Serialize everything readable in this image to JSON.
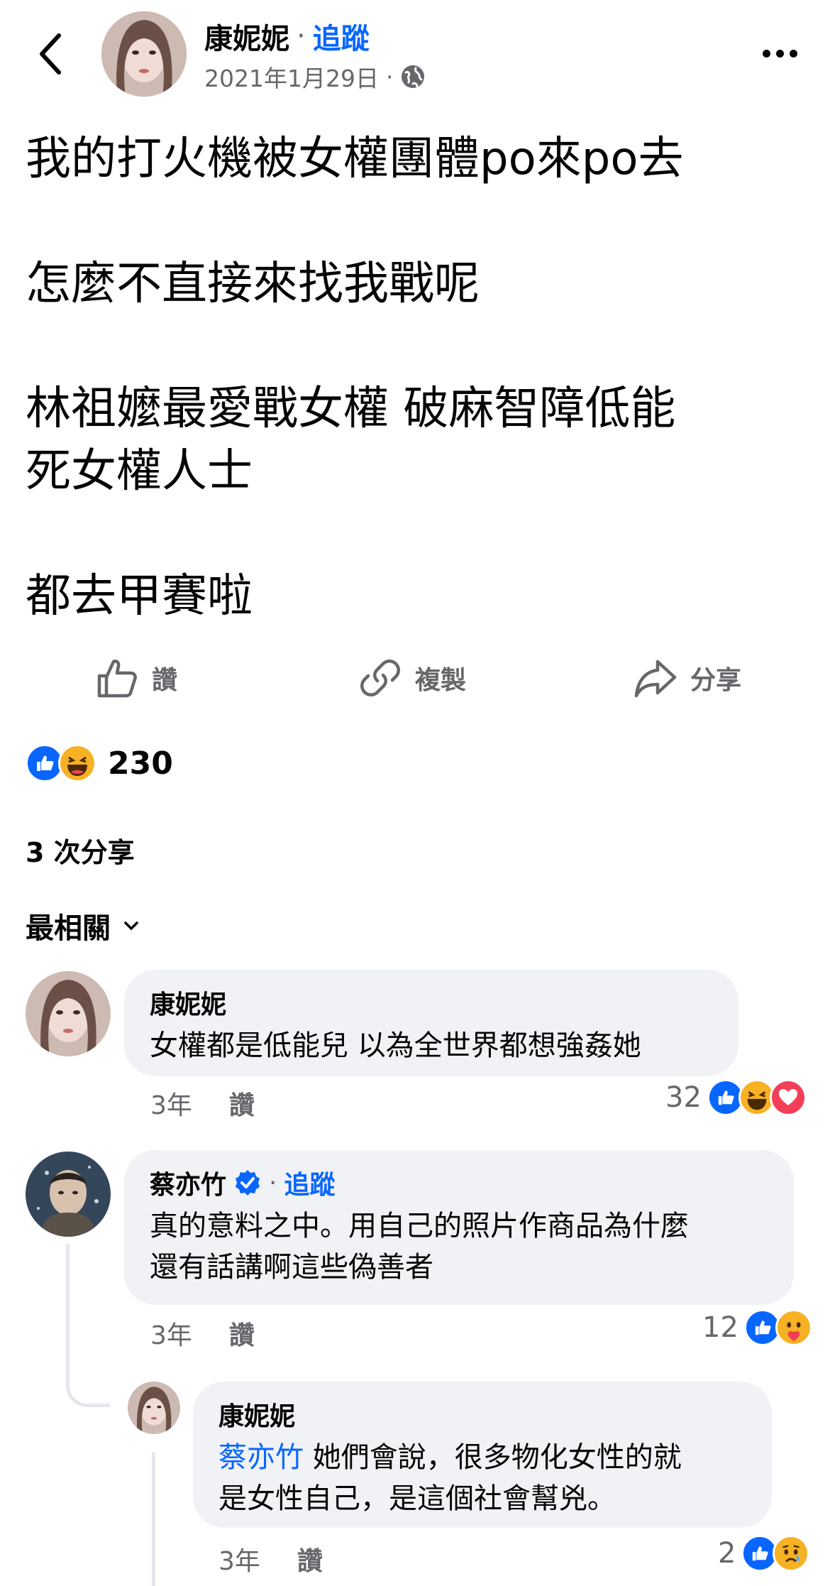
{
  "header": {
    "author": "康妮妮",
    "separator": "·",
    "follow": "追蹤",
    "date": "2021年1月29日",
    "date_dot": "·",
    "privacy_icon": "globe-icon"
  },
  "post": {
    "text": "我的打火機被女權團體po來po去\n\n怎麼不直接來找我戰呢\n\n林祖嬤最愛戰女權 破麻智障低能\n死女權人士\n\n都去甲賽啦"
  },
  "actions": {
    "like": "讚",
    "copy": "複製",
    "share": "分享"
  },
  "reactions": {
    "count": "230",
    "icons": [
      "like-icon",
      "haha-icon"
    ]
  },
  "shares_text": "3 次分享",
  "sort_label": "最相關",
  "comments": [
    {
      "name": "康妮妮",
      "text": "女權都是低能兒 以為全世界都想強姦她",
      "time": "3年",
      "like": "讚",
      "count": "32",
      "icons": [
        "like-icon",
        "haha-icon",
        "love-icon"
      ]
    },
    {
      "name": "蔡亦竹",
      "separator": "·",
      "follow": "追蹤",
      "verified_icon": "verified-badge-icon",
      "text": "真的意料之中。用自己的照片作商品為什麼\n還有話講啊這些偽善者",
      "time": "3年",
      "like": "讚",
      "count": "12",
      "icons": [
        "like-icon",
        "care-icon"
      ]
    },
    {
      "name": "康妮妮",
      "mention": "蔡亦竹",
      "text": " 她們會說，很多物化女性的就\n是女性自己，是這個社會幫兇。",
      "time": "3年",
      "like": "讚",
      "count": "2",
      "icons": [
        "like-icon",
        "sad-icon"
      ]
    }
  ],
  "colors": {
    "accent": "#0866ff",
    "secondary_text": "#65676b",
    "bubble": "#f0f2f5",
    "love": "#f33e58",
    "haha": "#f7b125"
  }
}
